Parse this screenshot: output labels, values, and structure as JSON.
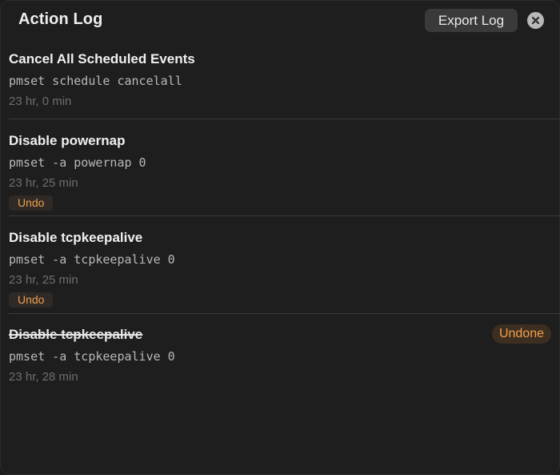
{
  "header": {
    "title": "Action Log",
    "export_label": "Export Log"
  },
  "entries": [
    {
      "name": "Cancel All Scheduled Events",
      "command": "pmset schedule cancelall",
      "time": "23 hr, 0 min"
    },
    {
      "name": "Disable powernap",
      "command": "pmset -a powernap 0",
      "time": "23 hr, 25 min",
      "undo_label": "Undo"
    },
    {
      "name": "Disable tcpkeepalive",
      "command": "pmset -a tcpkeepalive 0",
      "time": "23 hr, 25 min",
      "undo_label": "Undo"
    },
    {
      "name": "Disable tcpkeepalive",
      "command": "pmset -a tcpkeepalive 0",
      "time": "23 hr, 28 min",
      "status": "Undone",
      "struck_through": true
    }
  ],
  "colors": {
    "background": "#1e1e1e",
    "accent": "#f0a050",
    "muted_text": "#6e6e6e"
  },
  "icons": {
    "close": "close-icon"
  }
}
